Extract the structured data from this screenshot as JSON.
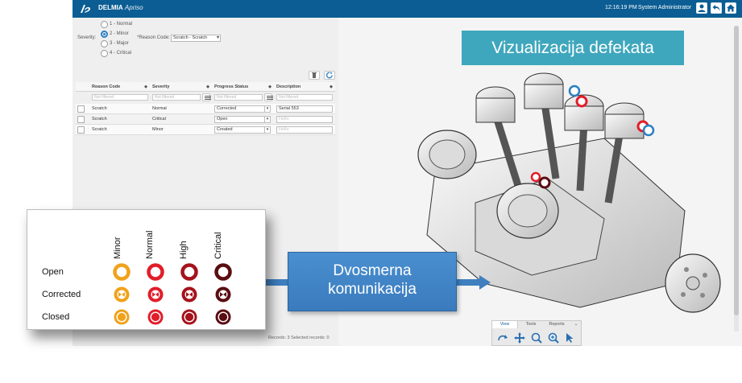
{
  "app": {
    "brand": "DELMIA",
    "product": "Apriso",
    "clock": "12:16:19 PM",
    "user": "System Administrator"
  },
  "severity": {
    "label": "Severity:",
    "options": [
      "1 - Normal",
      "2 - Minor",
      "3 - Major",
      "4 - Critical"
    ],
    "selected_index": 1
  },
  "reason_code": {
    "label": "*Reason Code:",
    "value": "Scratch - Scratch"
  },
  "grid": {
    "columns": [
      "Reason Code",
      "Severity",
      "Progress Status",
      "Description"
    ],
    "filter_placeholder": "Not filtered",
    "rows": [
      {
        "reason": "Scratch",
        "severity": "Normal",
        "status": "Corrected",
        "description": "Serial 553"
      },
      {
        "reason": "Scratch",
        "severity": "Critical",
        "status": "Open",
        "description": ""
      },
      {
        "reason": "Scratch",
        "severity": "Minor",
        "status": "Created",
        "description": ""
      }
    ],
    "description_placeholder": "Hello",
    "records": "Records: 3  Selected records: 0"
  },
  "viewer": {
    "title": "Vizualizacija defekata",
    "tabs": [
      "View",
      "Tools",
      "Reports"
    ],
    "tools": [
      "rotate-icon",
      "pan-icon",
      "zoom-fit-icon",
      "zoom-icon",
      "select-icon"
    ]
  },
  "callout": {
    "line1": "Dvosmerna",
    "line2": "komunikacija"
  },
  "legend": {
    "columns": [
      "Minor",
      "Normal",
      "High",
      "Critical"
    ],
    "rows": [
      "Open",
      "Corrected",
      "Closed"
    ],
    "colors": {
      "Minor": "#f0a21a",
      "Normal": "#e11d2a",
      "High": "#a5121c",
      "Critical": "#5a0e12"
    }
  }
}
